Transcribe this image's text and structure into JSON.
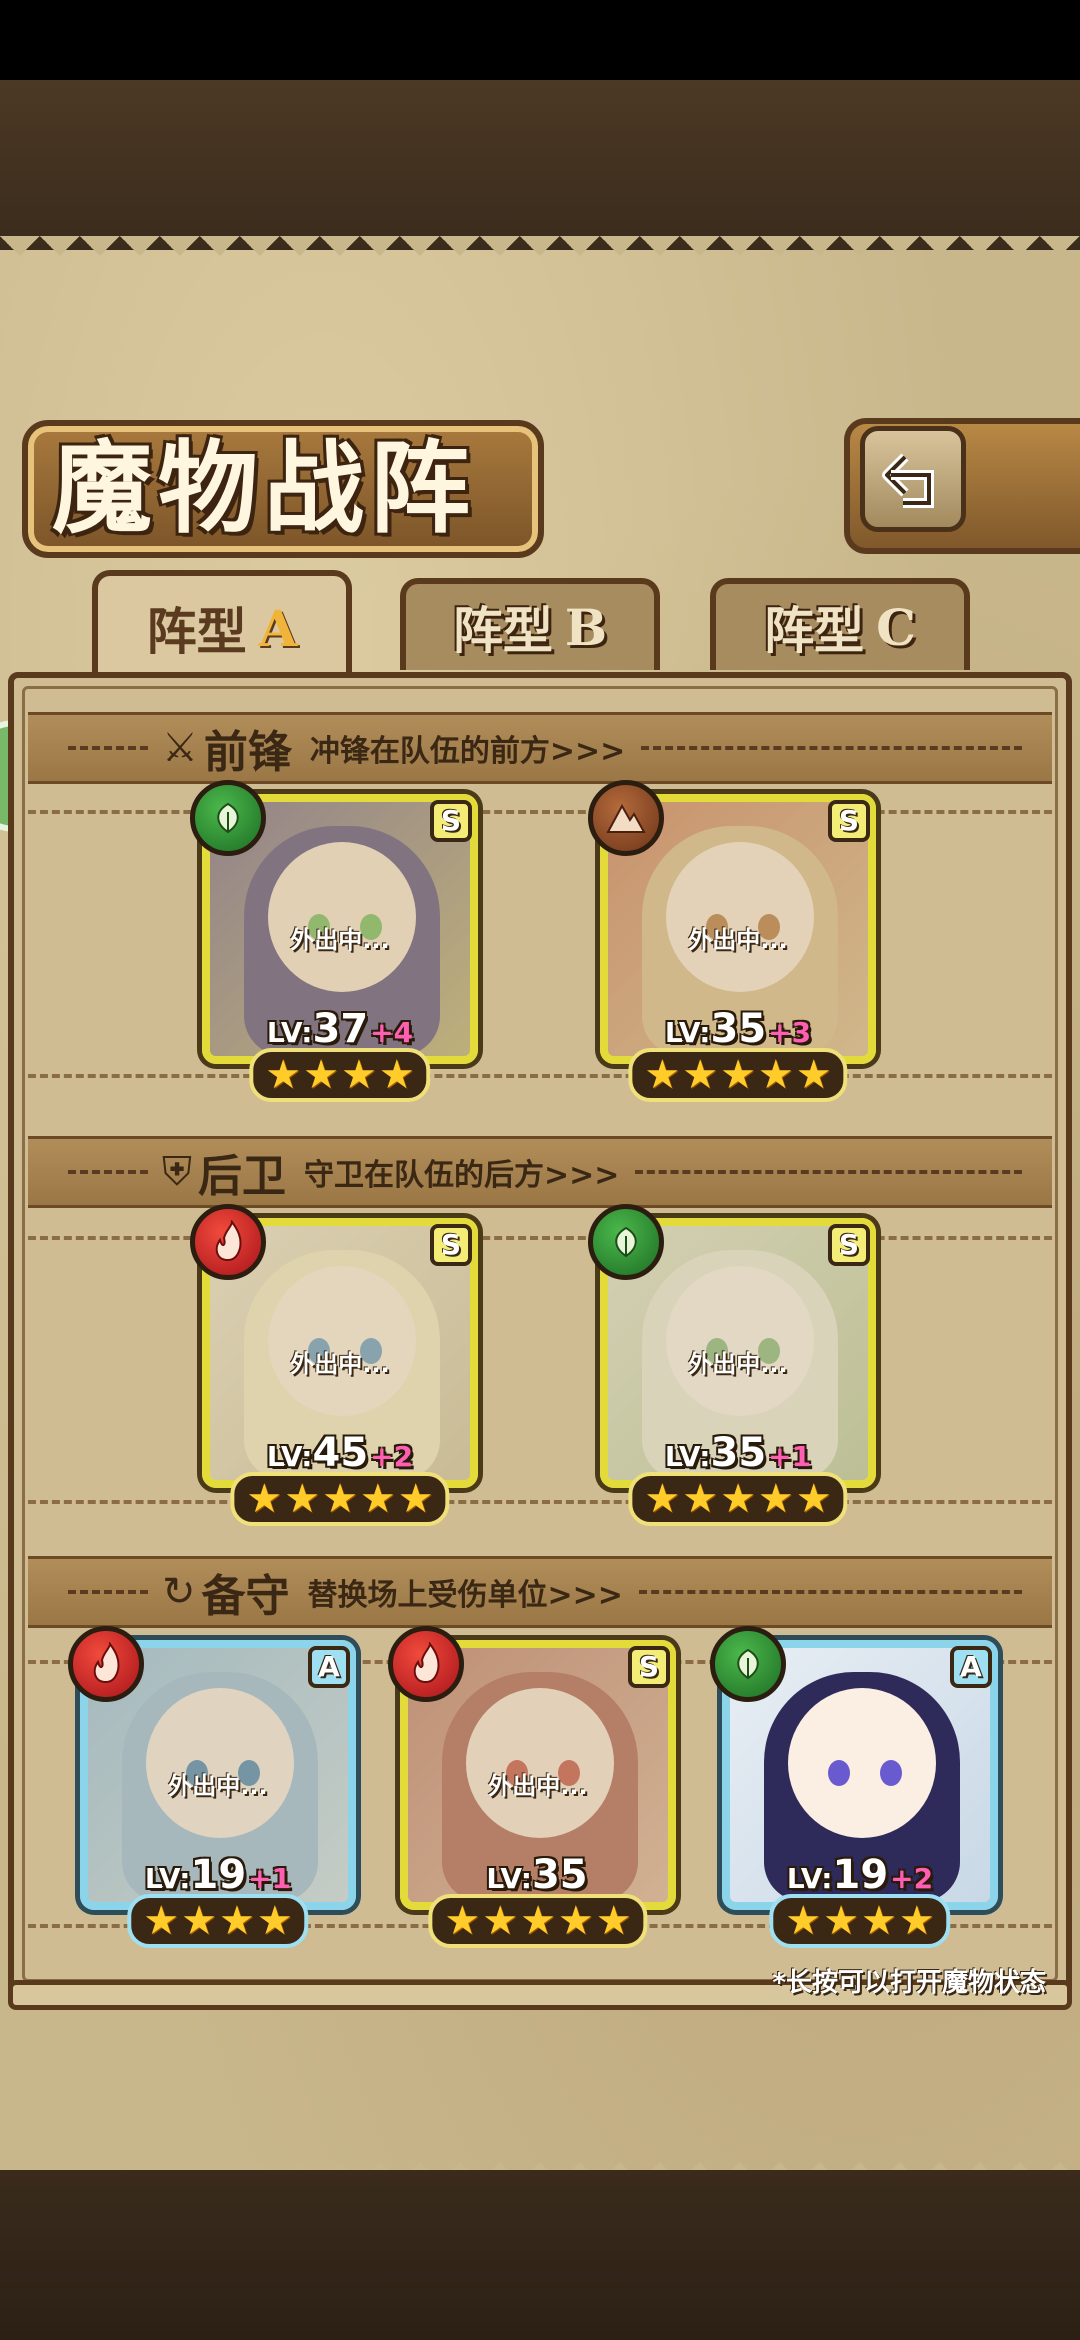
{
  "title": "魔物战阵",
  "tabs": [
    {
      "label": "阵型",
      "letter": "A",
      "active": true
    },
    {
      "label": "阵型",
      "letter": "B",
      "active": false
    },
    {
      "label": "阵型",
      "letter": "C",
      "active": false
    }
  ],
  "sections": {
    "front": {
      "icon": "sword-icon",
      "title": "前锋",
      "desc": "冲锋在队伍的前方>>>"
    },
    "back": {
      "icon": "shield-icon",
      "title": "后卫",
      "desc": "守卫在队伍的后方>>>"
    },
    "reserve": {
      "icon": "swap-icon",
      "title": "备守",
      "desc": "替换场上受伤单位>>>"
    }
  },
  "cards": {
    "front1": {
      "status": "外出中...",
      "lv_label": "LV:",
      "level": "37",
      "bonus": "+4",
      "rarity": "S",
      "element": "leaf-icon",
      "stars": 4
    },
    "front2": {
      "status": "外出中...",
      "lv_label": "LV:",
      "level": "35",
      "bonus": "+3",
      "rarity": "S",
      "element": "earth-icon",
      "stars": 5
    },
    "back1": {
      "status": "外出中...",
      "lv_label": "LV:",
      "level": "45",
      "bonus": "+2",
      "rarity": "S",
      "element": "fire-icon",
      "stars": 5
    },
    "back2": {
      "status": "外出中...",
      "lv_label": "LV:",
      "level": "35",
      "bonus": "+1",
      "rarity": "S",
      "element": "leaf-icon",
      "stars": 5
    },
    "res1": {
      "status": "外出中...",
      "lv_label": "LV:",
      "level": "19",
      "bonus": "+1",
      "rarity": "A",
      "element": "fire-icon",
      "stars": 4
    },
    "res2": {
      "status": "外出中...",
      "lv_label": "LV:",
      "level": "35",
      "bonus": "",
      "rarity": "S",
      "element": "fire-icon",
      "stars": 5
    },
    "res3": {
      "status": "",
      "lv_label": "LV:",
      "level": "19",
      "bonus": "+2",
      "rarity": "A",
      "element": "leaf-icon",
      "stars": 4
    }
  },
  "footnote": "*长按可以打开魔物状态",
  "star_glyph": "★",
  "colors": {
    "parchment": "#c9b78c",
    "frame_s": "#e3db3a",
    "frame_a": "#8cd4ea",
    "level_bonus": "#ff5fb2"
  }
}
